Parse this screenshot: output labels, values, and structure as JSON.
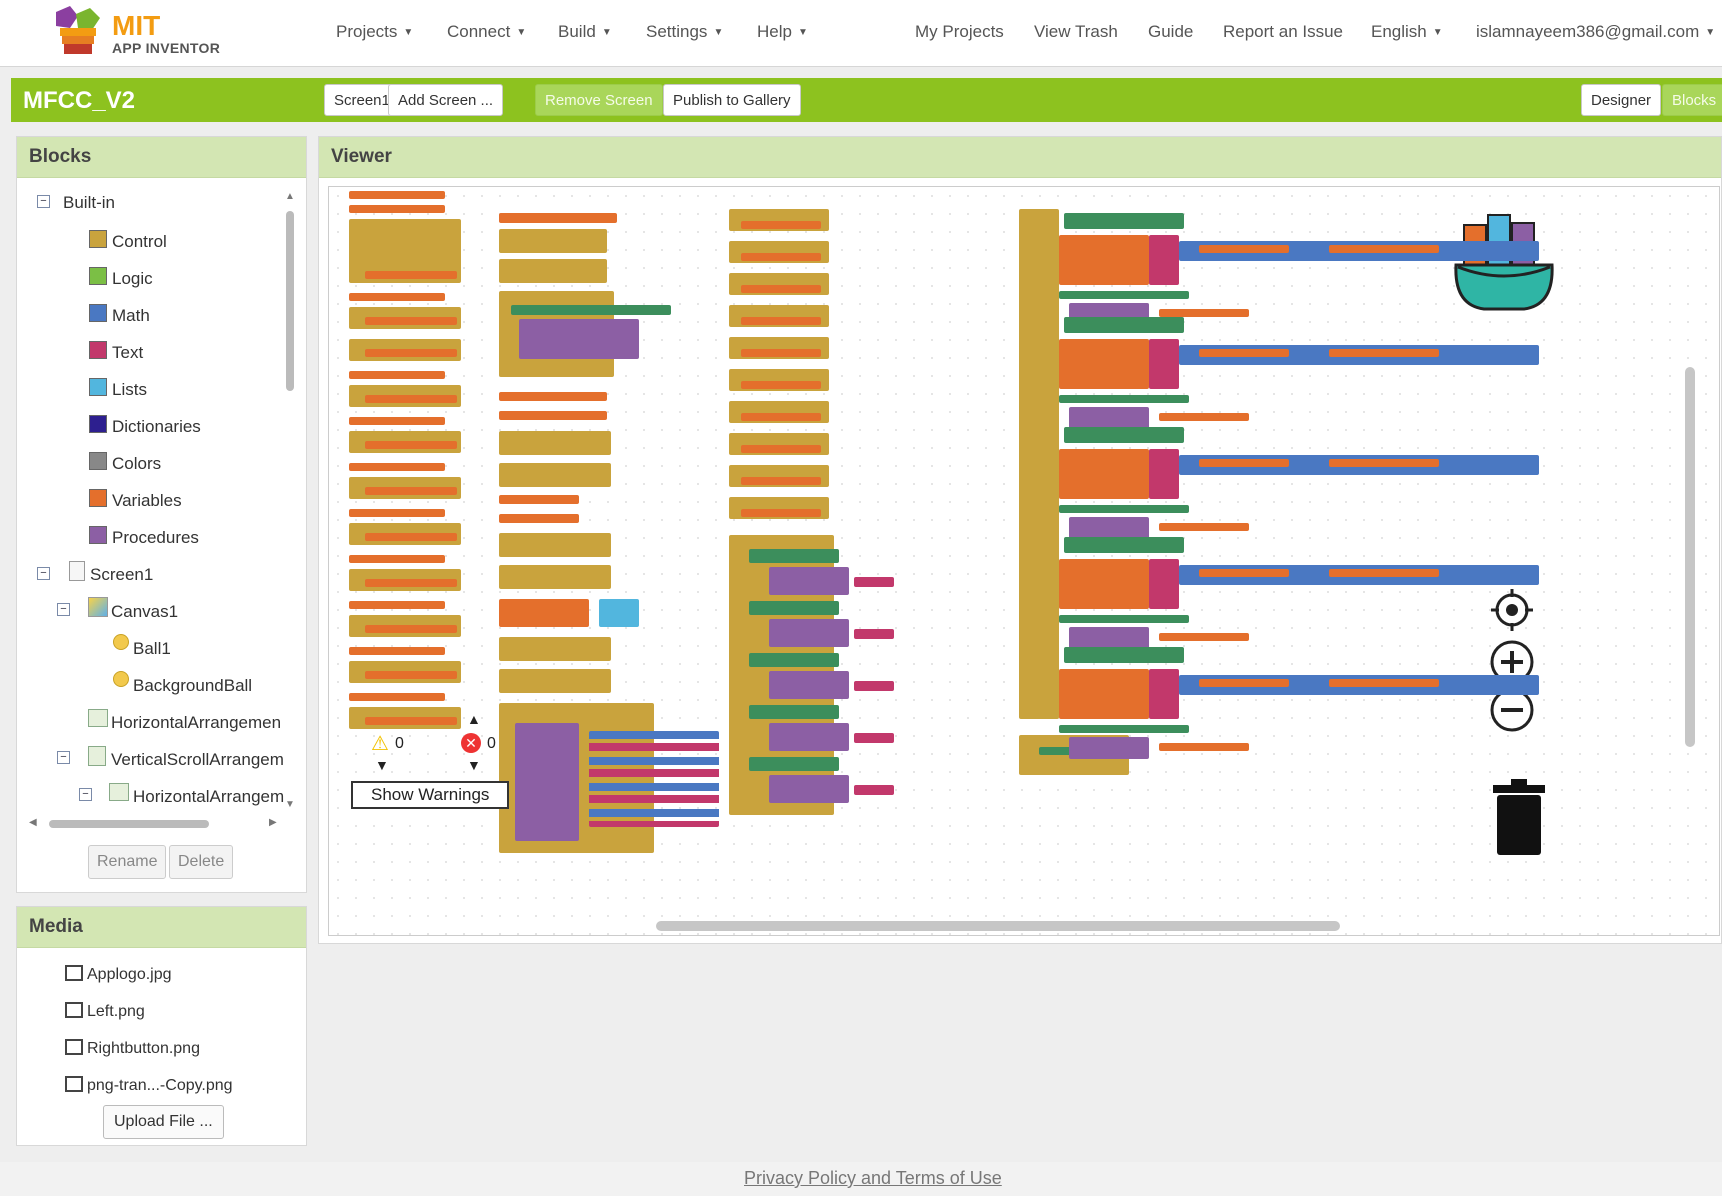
{
  "app": {
    "logo_mit": "MIT",
    "logo_sub": "APP INVENTOR"
  },
  "nav": {
    "menus": [
      "Projects",
      "Connect",
      "Build",
      "Settings",
      "Help"
    ],
    "links": [
      "My Projects",
      "View Trash",
      "Guide",
      "Report an Issue"
    ],
    "language": "English",
    "account": "islamnayeem386@gmail.com"
  },
  "toolbar": {
    "project_name": "MFCC_V2",
    "screen_select": "Screen1",
    "add_screen": "Add Screen ...",
    "remove_screen": "Remove Screen",
    "publish": "Publish to Gallery",
    "designer": "Designer",
    "blocks": "Blocks"
  },
  "blocks_panel": {
    "title": "Blocks",
    "builtin_label": "Built-in",
    "builtin": [
      {
        "label": "Control",
        "color": "#c9a33d"
      },
      {
        "label": "Logic",
        "color": "#7bbf45"
      },
      {
        "label": "Math",
        "color": "#4a78c2"
      },
      {
        "label": "Text",
        "color": "#c2386b"
      },
      {
        "label": "Lists",
        "color": "#52b6de"
      },
      {
        "label": "Dictionaries",
        "color": "#2d1f8f"
      },
      {
        "label": "Colors",
        "color": "#888888"
      },
      {
        "label": "Variables",
        "color": "#e46f2c"
      },
      {
        "label": "Procedures",
        "color": "#8c5fa4"
      }
    ],
    "components": [
      "Screen1",
      "Canvas1",
      "Ball1",
      "BackgroundBall",
      "HorizontalArrangemen",
      "VerticalScrollArrangem",
      "HorizontalArrangem"
    ],
    "rename": "Rename",
    "delete": "Delete"
  },
  "media_panel": {
    "title": "Media",
    "files": [
      "Applogo.jpg",
      "Left.png",
      "Rightbutton.png",
      "png-tran...-Copy.png"
    ],
    "upload": "Upload File ..."
  },
  "viewer": {
    "title": "Viewer",
    "warnings_count": "0",
    "errors_count": "0",
    "show_warnings": "Show Warnings"
  },
  "footer": {
    "privacy": "Privacy Policy and Terms of Use"
  }
}
